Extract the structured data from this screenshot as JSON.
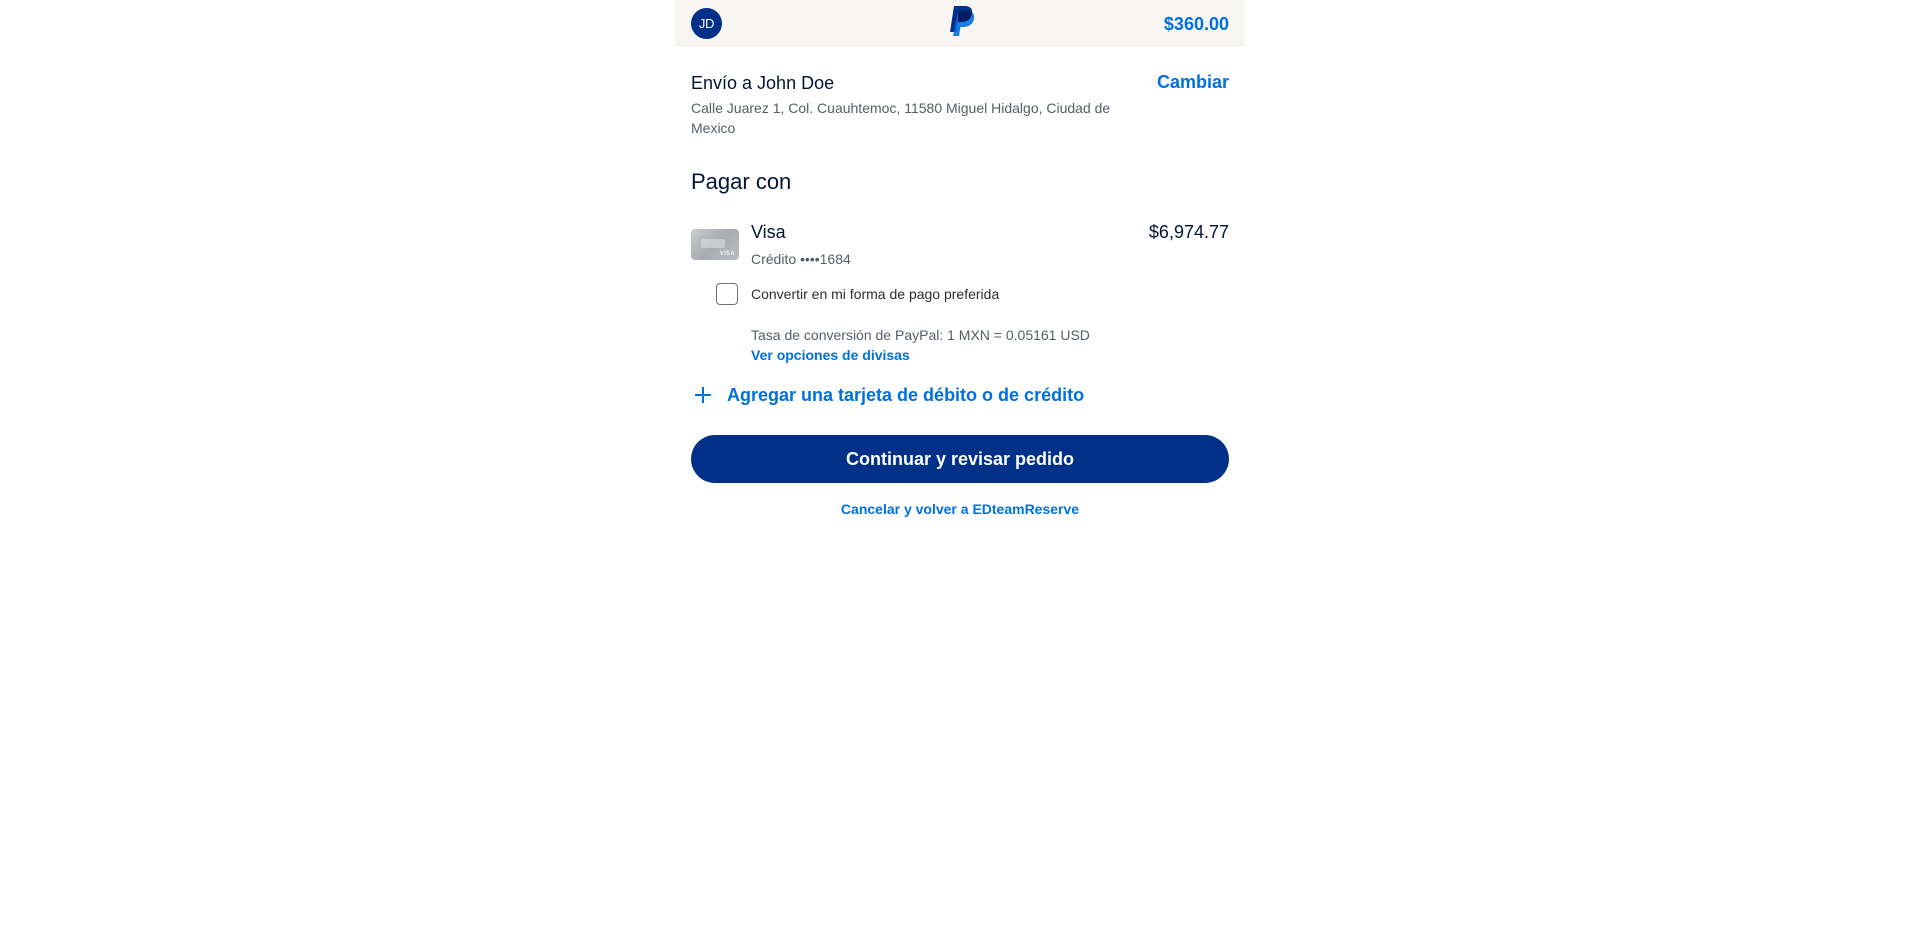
{
  "header": {
    "avatar_initials": "JD",
    "logo_icon": "paypal-logo",
    "total": "$360.00",
    "brand_color": "#003087",
    "accent_color": "#0070e0"
  },
  "shipping": {
    "title": "Envío a John Doe",
    "change_label": "Cambiar",
    "address": "Calle Juarez 1, Col. Cuauhtemoc, 11580 Miguel Hidalgo, Ciudad de Mexico"
  },
  "payment": {
    "title": "Pagar con",
    "method": {
      "name": "Visa",
      "detail": "Crédito ••••1684",
      "amount": "$6,974.77",
      "card_icon": "visa-card-icon"
    },
    "preferred_label": "Convertir en mi forma de pago preferida",
    "preferred_checked": false,
    "conversion_text": "Tasa de conversión de PayPal: 1 MXN = 0.05161 USD",
    "currency_options_link": "Ver opciones de divisas",
    "add_card_label": "Agregar una tarjeta de débito o de crédito"
  },
  "actions": {
    "continue_label": "Continuar y revisar pedido",
    "cancel_label": "Cancelar y volver a EDteamReserve"
  }
}
